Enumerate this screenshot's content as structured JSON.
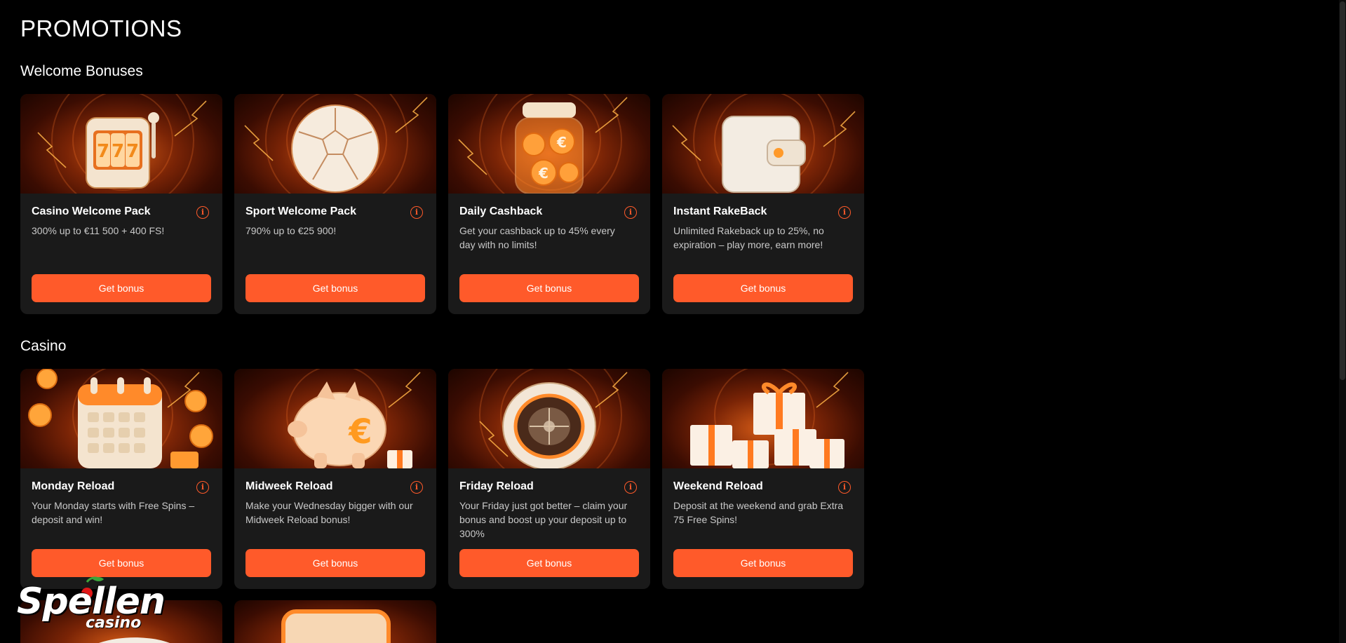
{
  "page": {
    "title": "PROMOTIONS"
  },
  "sections": [
    {
      "title": "Welcome Bonuses",
      "cards": [
        {
          "name": "Casino Welcome Pack",
          "description": "300% up to €11 500 + 400 FS!",
          "button": "Get bonus",
          "image": "slot-machine-777"
        },
        {
          "name": "Sport Welcome Pack",
          "description": "790% up to €25 900!",
          "button": "Get bonus",
          "image": "soccer-ball"
        },
        {
          "name": "Daily Cashback",
          "description": "Get your cashback up to 45% every day with no limits!",
          "button": "Get bonus",
          "image": "coin-jar"
        },
        {
          "name": "Instant RakeBack",
          "description": "Unlimited Rakeback up to 25%, no expiration – play more, earn more!",
          "button": "Get bonus",
          "image": "wallet"
        }
      ]
    },
    {
      "title": "Casino",
      "cards": [
        {
          "name": "Monday Reload",
          "description": "Your Monday starts with Free Spins – deposit and win!",
          "button": "Get bonus",
          "image": "calendar-coins"
        },
        {
          "name": "Midweek Reload",
          "description": "Make your Wednesday bigger with our Midweek Reload bonus!",
          "button": "Get bonus",
          "image": "piggy-bank"
        },
        {
          "name": "Friday Reload",
          "description": "Your Friday just got better – claim your bonus and boost up your deposit up to 300%",
          "button": "Get bonus",
          "image": "roulette-wheel"
        },
        {
          "name": "Weekend Reload",
          "description": "Deposit at the weekend and grab Extra 75 Free Spins!",
          "button": "Get bonus",
          "image": "gift-boxes"
        }
      ]
    }
  ],
  "logo": {
    "main": "Spellen",
    "sub": "casino"
  },
  "colors": {
    "accent": "#ff5a2a",
    "card_bg": "#1a1a1a",
    "page_bg": "#000000"
  }
}
